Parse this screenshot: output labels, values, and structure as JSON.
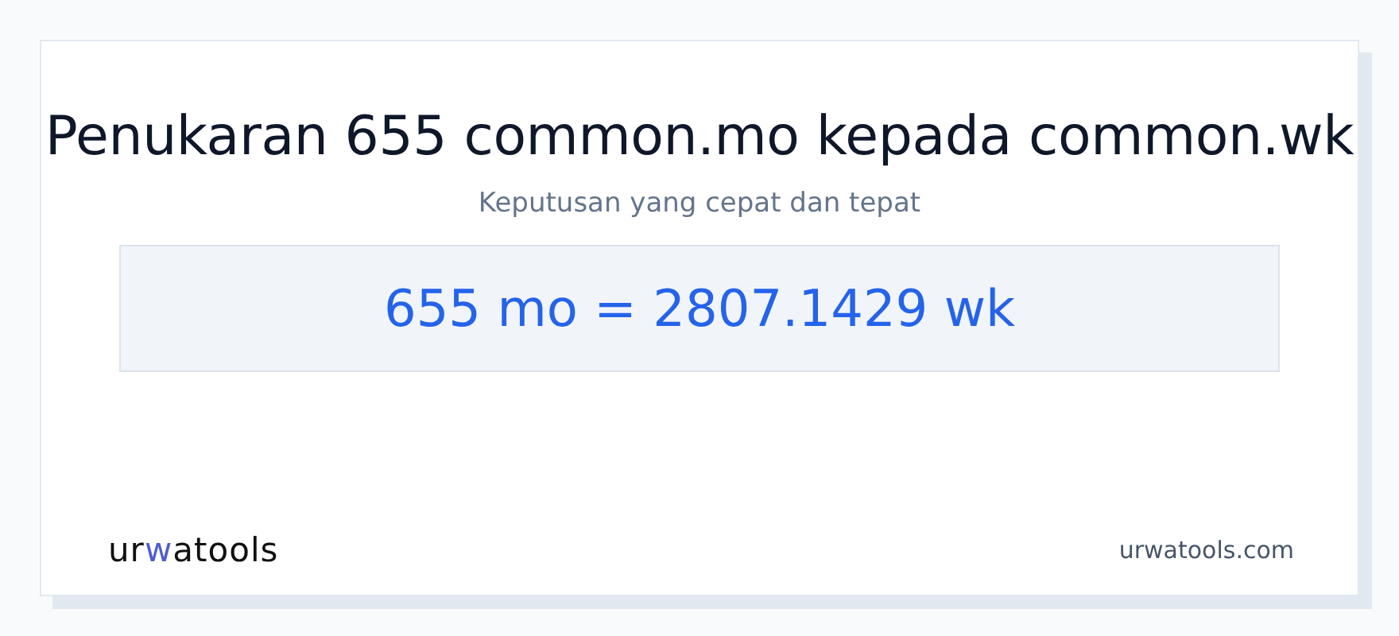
{
  "title": "Penukaran 655 common.mo kepada common.wk",
  "subtitle": "Keputusan yang cepat dan tepat",
  "result": "655 mo = 2807.1429 wk",
  "logo": [
    {
      "text": "ur",
      "accent": false
    },
    {
      "text": "w",
      "accent": true
    },
    {
      "text": "atools",
      "accent": false
    }
  ],
  "site": "urwatools.com"
}
